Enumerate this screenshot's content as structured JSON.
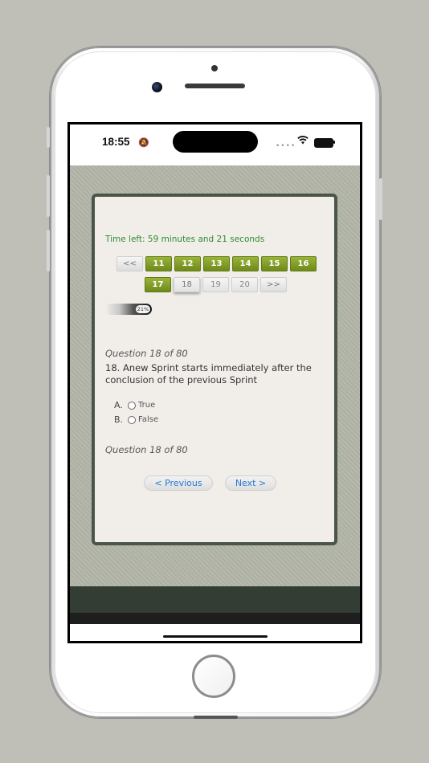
{
  "status_bar": {
    "time": "18:55",
    "bell_icon": "🔕",
    "signal_icon": "••••",
    "wifi_icon": "wifi-icon"
  },
  "quiz": {
    "timer_text": "Time left: 59 minutes and 21 seconds",
    "pager_row1": [
      {
        "label": "<<",
        "state": "nav"
      },
      {
        "label": "11",
        "state": "done"
      },
      {
        "label": "12",
        "state": "done"
      },
      {
        "label": "13",
        "state": "done"
      },
      {
        "label": "14",
        "state": "done"
      },
      {
        "label": "15",
        "state": "done"
      },
      {
        "label": "16",
        "state": "done"
      }
    ],
    "pager_row2": [
      {
        "label": "17",
        "state": "done"
      },
      {
        "label": "18",
        "state": "current"
      },
      {
        "label": "19",
        "state": "todo"
      },
      {
        "label": "20",
        "state": "todo"
      },
      {
        "label": ">>",
        "state": "nav"
      }
    ],
    "progress_label": "21%",
    "progress_fraction": 0.21,
    "question_count_top": "Question 18 of 80",
    "question_text": "18. Anew Sprint starts immediately after the conclusion of the previous Sprint",
    "options": [
      {
        "letter": "A.",
        "text": "True"
      },
      {
        "letter": "B.",
        "text": "False"
      }
    ],
    "question_count_bottom": "Question 18 of 80",
    "prev_label": "< Previous",
    "next_label": "Next >"
  },
  "colors": {
    "accent_green": "#7d9922",
    "timer_green": "#2e8b2e",
    "link_blue": "#2a7ad0"
  }
}
